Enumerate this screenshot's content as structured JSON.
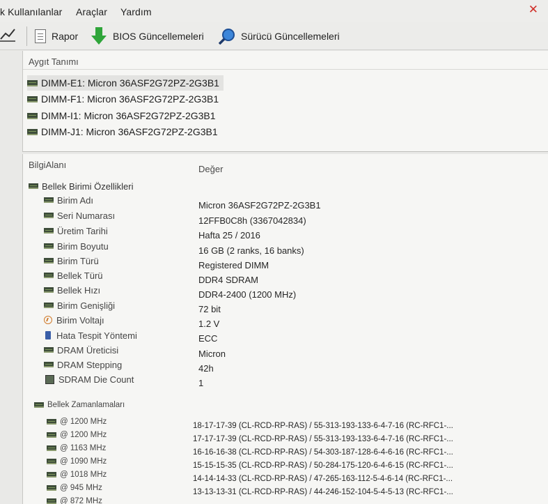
{
  "menu": {
    "items": [
      "k Kullanılanlar",
      "Araçlar",
      "Yardım"
    ]
  },
  "toolbar": {
    "report_label": "Rapor",
    "bios_label": "BIOS Güncellemeleri",
    "driver_label": "Sürücü Güncellemeleri"
  },
  "devices": {
    "header": "Aygıt Tanımı",
    "items": [
      "DIMM-E1: Micron 36ASF2G72PZ-2G3B1",
      "DIMM-F1: Micron 36ASF2G72PZ-2G3B1",
      "DIMM-I1: Micron 36ASF2G72PZ-2G3B1",
      "DIMM-J1: Micron 36ASF2G72PZ-2G3B1"
    ]
  },
  "info": {
    "col_field": "BilgiAlanı",
    "col_value": "Değer",
    "section1": "Bellek Birimi Özellikleri",
    "properties": [
      {
        "label": "Birim Adı",
        "value": "Micron 36ASF2G72PZ-2G3B1",
        "icon": "memory-module-icon"
      },
      {
        "label": "Seri Numarası",
        "value": "12FFB0C8h (3367042834)",
        "icon": "memory-module-icon"
      },
      {
        "label": "Üretim Tarihi",
        "value": "Hafta 25 / 2016",
        "icon": "memory-module-icon"
      },
      {
        "label": "Birim Boyutu",
        "value": "16 GB (2 ranks, 16 banks)",
        "icon": "memory-module-icon"
      },
      {
        "label": "Birim Türü",
        "value": "Registered DIMM",
        "icon": "memory-module-icon"
      },
      {
        "label": "Bellek Türü",
        "value": "DDR4 SDRAM",
        "icon": "memory-module-icon"
      },
      {
        "label": "Bellek Hızı",
        "value": "DDR4-2400 (1200 MHz)",
        "icon": "memory-module-icon"
      },
      {
        "label": "Birim Genişliği",
        "value": "72 bit",
        "icon": "memory-module-icon"
      },
      {
        "label": "Birim Voltajı",
        "value": "1.2 V",
        "icon": "voltage-icon"
      },
      {
        "label": "Hata Tespit Yöntemi",
        "value": "ECC",
        "icon": "ecc-icon"
      },
      {
        "label": "DRAM Üreticisi",
        "value": "Micron",
        "icon": "memory-module-icon"
      },
      {
        "label": "DRAM Stepping",
        "value": "42h",
        "icon": "memory-module-icon"
      },
      {
        "label": "SDRAM Die Count",
        "value": "1",
        "icon": "chip-icon"
      }
    ],
    "section2": "Bellek Zamanlamaları",
    "timings": [
      {
        "label": "@ 1200 MHz",
        "value": "18-17-17-39  (CL-RCD-RP-RAS) / 55-313-193-133-6-4-7-16  (RC-RFC1-..."
      },
      {
        "label": "@ 1200 MHz",
        "value": "17-17-17-39  (CL-RCD-RP-RAS) / 55-313-193-133-6-4-7-16  (RC-RFC1-..."
      },
      {
        "label": "@ 1163 MHz",
        "value": "16-16-16-38  (CL-RCD-RP-RAS) / 54-303-187-128-6-4-6-16  (RC-RFC1-..."
      },
      {
        "label": "@ 1090 MHz",
        "value": "15-15-15-35  (CL-RCD-RP-RAS) / 50-284-175-120-6-4-6-15  (RC-RFC1-..."
      },
      {
        "label": "@ 1018 MHz",
        "value": "14-14-14-33  (CL-RCD-RP-RAS) / 47-265-163-112-5-4-6-14  (RC-RFC1-..."
      },
      {
        "label": "@ 945 MHz",
        "value": "13-13-13-31  (CL-RCD-RP-RAS) / 44-246-152-104-5-4-5-13  (RC-RFC1-..."
      },
      {
        "label": "@ 872 MHz",
        "value": ""
      }
    ]
  },
  "colors": {
    "accent_green": "#2fa53a",
    "accent_blue": "#2a6fd0",
    "close_red": "#d0302a"
  }
}
